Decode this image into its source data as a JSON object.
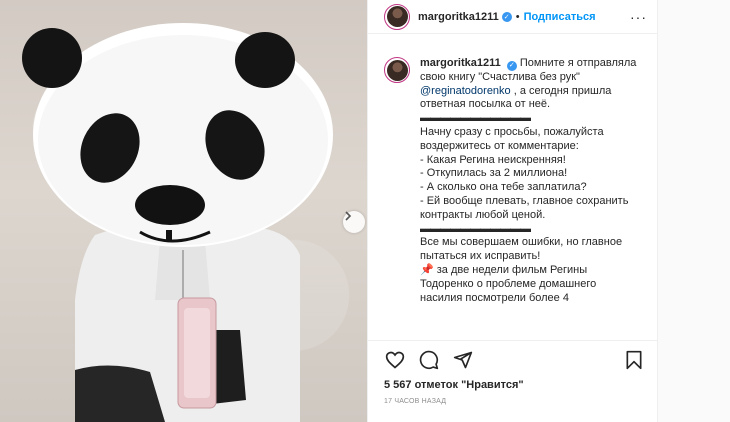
{
  "post": {
    "username": "margoritka1211",
    "verified_glyph": "✓",
    "separator": "•",
    "follow_label": "Подписаться",
    "more_label": "···"
  },
  "caption": {
    "username": "margoritka1211",
    "line1_pre": "Помните я отправляла свою книгу \"Счастлива без рук\" ",
    "mention": "@reginatodorenko",
    "line1_post": " , а сегодня пришла ответная посылка от неё.",
    "dashes": "▬▬▬▬▬▬▬▬▬▬▬",
    "para2": "Начну сразу с просьбы, пожалуйста воздержитесь от комментарие:",
    "items": [
      "- Какая Регина неискренняя!",
      "- Откупилась за 2 миллиона!",
      "- А сколько она тебе заплатила?",
      "- Ей вообще плевать, главное сохранить контракты любой ценой."
    ],
    "para3": "Все мы совершаем ошибки, но главное пытаться их исправить!",
    "pin_glyph": "📌",
    "para4": " за две недели фильм Регины Тодоренко о проблеме домашнего насилия посмотрели более 4"
  },
  "actions": {
    "like_icon": "heart-icon",
    "comment_icon": "comment-icon",
    "share_icon": "share-icon",
    "save_icon": "bookmark-icon"
  },
  "likes": {
    "count_text": "5 567 отметок",
    "link_text": "\"Нравится\""
  },
  "timestamp": "17 часов назад",
  "colors": {
    "accent": "#0095f6",
    "verified": "#3897f0",
    "text": "#262626",
    "muted": "#8e8e8e",
    "border": "#efefef"
  }
}
